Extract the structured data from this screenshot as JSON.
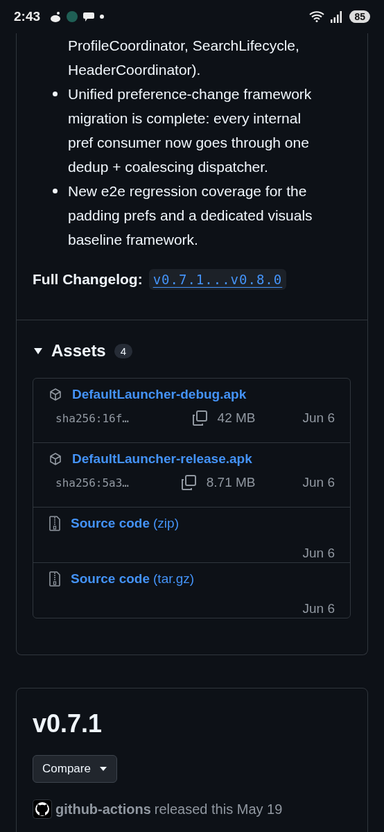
{
  "status_bar": {
    "time": "2:43",
    "battery": "85"
  },
  "release_notes": [
    {
      "kind": "continuation",
      "text": "ProfileCoordinator, SearchLifecycle, HeaderCoordinator)."
    },
    {
      "kind": "bullet",
      "text": "Unified preference-change framework migration is complete: every internal pref consumer now goes through one dedup + coalescing dispatcher."
    },
    {
      "kind": "bullet",
      "text": "New e2e regression coverage for the padding prefs and a dedicated visuals baseline framework."
    }
  ],
  "full_changelog": {
    "label": "Full Changelog:",
    "link": "v0.7.1...v0.8.0"
  },
  "assets": {
    "title": "Assets",
    "count": "4",
    "expanded": true,
    "items": [
      {
        "kind": "package",
        "name": "DefaultLauncher-debug.apk",
        "sha": "sha256:16f…",
        "size": "42 MB",
        "date": "Jun 6"
      },
      {
        "kind": "package",
        "name": "DefaultLauncher-release.apk",
        "sha": "sha256:5a3…",
        "size": "8.71 MB",
        "date": "Jun 6"
      },
      {
        "kind": "source",
        "name": "Source code",
        "format": "(zip)",
        "date": "Jun 6"
      },
      {
        "kind": "source",
        "name": "Source code",
        "format": "(tar.gz)",
        "date": "Jun 6"
      }
    ]
  },
  "next_release": {
    "version": "v0.7.1",
    "compare_button": "Compare",
    "author": "github-actions",
    "released_text": "released this May 19"
  }
}
